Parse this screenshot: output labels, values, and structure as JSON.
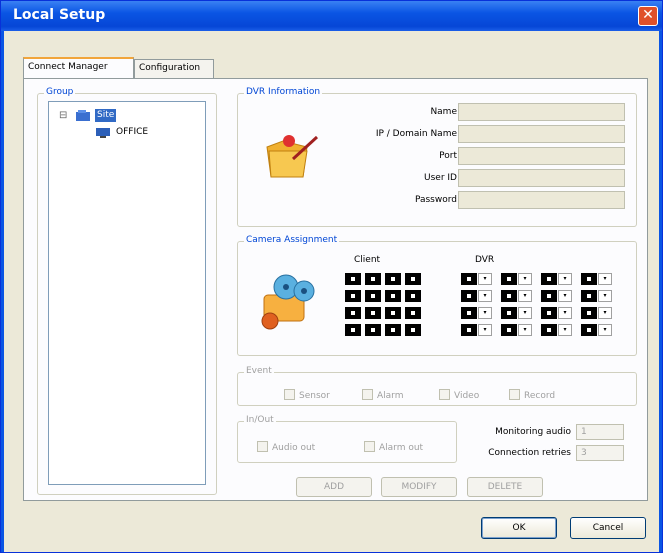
{
  "window": {
    "title": "Local Setup",
    "close_glyph": "✕"
  },
  "tabs": [
    {
      "label": "Connect Manager",
      "active": true
    },
    {
      "label": "Configuration",
      "active": false
    }
  ],
  "group": {
    "label": "Group",
    "tree": [
      {
        "label": "Site",
        "selected": true,
        "expander": "⊟"
      },
      {
        "label": "OFFICE"
      }
    ]
  },
  "dvr_info": {
    "label": "DVR Information",
    "fields": [
      {
        "label": "Name",
        "value": ""
      },
      {
        "label": "IP / Domain Name",
        "value": ""
      },
      {
        "label": "Port",
        "value": ""
      },
      {
        "label": "User ID",
        "value": ""
      },
      {
        "label": "Password",
        "value": ""
      }
    ]
  },
  "camera": {
    "label": "Camera Assignment",
    "client_label": "Client",
    "dvr_label": "DVR",
    "dropdown_glyph": "▾"
  },
  "event": {
    "label": "Event",
    "options": [
      "Sensor",
      "Alarm",
      "Video",
      "Record"
    ]
  },
  "inout": {
    "label": "In/Out",
    "options": [
      "Audio out",
      "Alarm out"
    ],
    "monitoring_audio": {
      "label": "Monitoring audio",
      "value": "1"
    },
    "connection_retries": {
      "label": "Connection retries",
      "value": "3"
    }
  },
  "actions": {
    "add": "ADD",
    "modify": "MODIFY",
    "delete": "DELETE"
  },
  "footer": {
    "ok": "OK",
    "cancel": "Cancel"
  }
}
